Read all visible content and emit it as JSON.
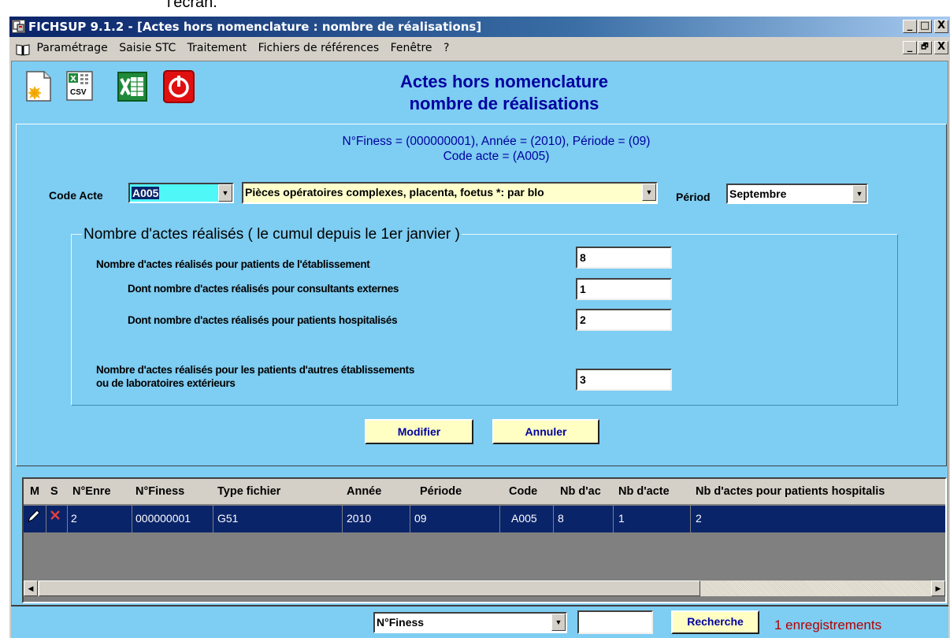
{
  "caption_fragment": "l'écran.",
  "window": {
    "title": "FICHSUP 9.1.2 - [Actes hors nomenclature : nombre de réalisations]",
    "controls": [
      "_",
      "□",
      "X"
    ],
    "mdi_controls": [
      "_",
      "🗗",
      "X"
    ]
  },
  "menu": {
    "items": [
      "Paramétrage",
      "Saisie STC",
      "Traitement",
      "Fichiers de références",
      "Fenêtre",
      "?"
    ]
  },
  "toolbar": {
    "csv_label": "CSV",
    "icons": [
      "new-document-icon",
      "export-csv-icon",
      "excel-icon",
      "power-exit-icon"
    ]
  },
  "form": {
    "heading_line1": "Actes hors nomenclature",
    "heading_line2": "nombre de réalisations",
    "info_line1": "N°Finess = (000000001), Année = (2010), Période = (09)",
    "info_line2": "Code acte = (A005)",
    "code_acte_label": "Code Acte",
    "code_acte_value": "A005",
    "acte_description": "Pièces opératoires complexes, placenta, foetus *: par blo",
    "periode_label": "Périod",
    "periode_value": "Septembre",
    "group_title": "Nombre d'actes réalisés ( le cumul depuis le 1er janvier )",
    "rows": [
      {
        "label": "Nombre d'actes réalisés pour patients de l'établissement",
        "value": "8"
      },
      {
        "label": "Dont nombre d'actes réalisés pour consultants externes",
        "value": "1"
      },
      {
        "label": "Dont nombre d'actes réalisés pour patients hospitalisés",
        "value": "2"
      },
      {
        "label_line1": "Nombre d'actes réalisés pour les patients d'autres établissements",
        "label_line2": "ou de laboratoires extérieurs",
        "value": "3"
      }
    ],
    "modify_label": "Modifier",
    "cancel_label": "Annuler"
  },
  "grid": {
    "headers": [
      "M",
      "S",
      "N°Enre",
      "N°Finess",
      "Type fichier",
      "Année",
      "Période",
      "Code",
      "Nb d'ac",
      "Nb d'acte",
      "Nb d'actes pour patients hospitalis"
    ],
    "row": {
      "enre": "2",
      "finess": "000000001",
      "type": "G51",
      "annee": "2010",
      "periode": "09",
      "code": "A005",
      "nb1": "8",
      "nb2": "1",
      "nb3": "2"
    }
  },
  "status": {
    "search_field": "N°Finess",
    "search_value": "",
    "search_button": "Recherche",
    "count": "1 enregistrements"
  },
  "colors": {
    "background": "#7ecdf2",
    "heading": "#0000a0",
    "button_bg": "#ffffc4",
    "selected_row": "#0a246a",
    "count_text": "#b40000"
  }
}
